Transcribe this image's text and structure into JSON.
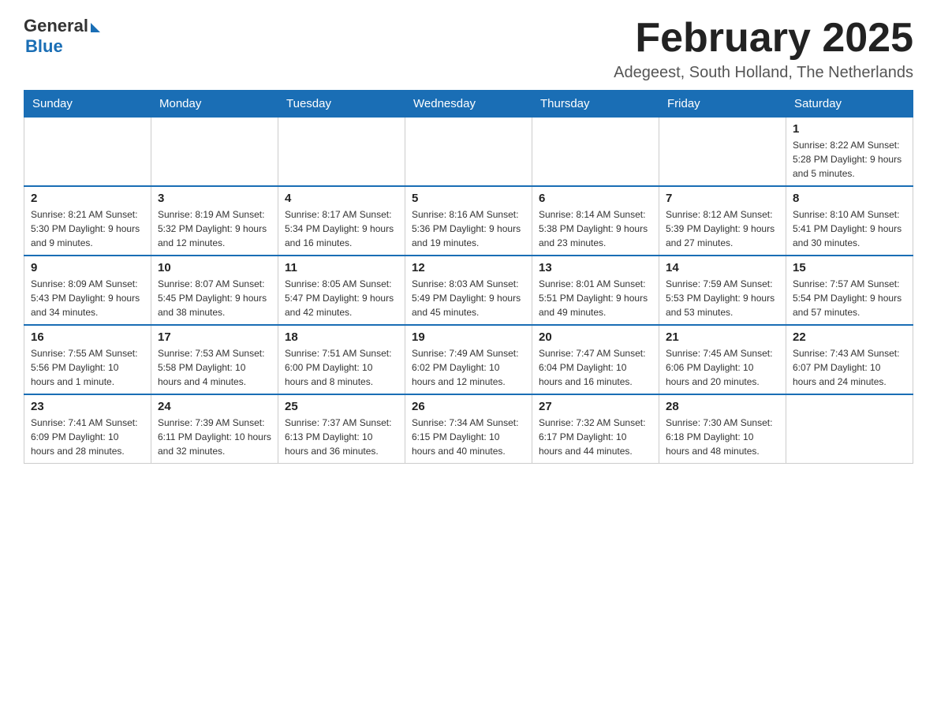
{
  "logo": {
    "general": "General",
    "blue": "Blue"
  },
  "header": {
    "title": "February 2025",
    "subtitle": "Adegeest, South Holland, The Netherlands"
  },
  "days_of_week": [
    "Sunday",
    "Monday",
    "Tuesday",
    "Wednesday",
    "Thursday",
    "Friday",
    "Saturday"
  ],
  "weeks": [
    [
      {
        "day": "",
        "info": ""
      },
      {
        "day": "",
        "info": ""
      },
      {
        "day": "",
        "info": ""
      },
      {
        "day": "",
        "info": ""
      },
      {
        "day": "",
        "info": ""
      },
      {
        "day": "",
        "info": ""
      },
      {
        "day": "1",
        "info": "Sunrise: 8:22 AM\nSunset: 5:28 PM\nDaylight: 9 hours and 5 minutes."
      }
    ],
    [
      {
        "day": "2",
        "info": "Sunrise: 8:21 AM\nSunset: 5:30 PM\nDaylight: 9 hours and 9 minutes."
      },
      {
        "day": "3",
        "info": "Sunrise: 8:19 AM\nSunset: 5:32 PM\nDaylight: 9 hours and 12 minutes."
      },
      {
        "day": "4",
        "info": "Sunrise: 8:17 AM\nSunset: 5:34 PM\nDaylight: 9 hours and 16 minutes."
      },
      {
        "day": "5",
        "info": "Sunrise: 8:16 AM\nSunset: 5:36 PM\nDaylight: 9 hours and 19 minutes."
      },
      {
        "day": "6",
        "info": "Sunrise: 8:14 AM\nSunset: 5:38 PM\nDaylight: 9 hours and 23 minutes."
      },
      {
        "day": "7",
        "info": "Sunrise: 8:12 AM\nSunset: 5:39 PM\nDaylight: 9 hours and 27 minutes."
      },
      {
        "day": "8",
        "info": "Sunrise: 8:10 AM\nSunset: 5:41 PM\nDaylight: 9 hours and 30 minutes."
      }
    ],
    [
      {
        "day": "9",
        "info": "Sunrise: 8:09 AM\nSunset: 5:43 PM\nDaylight: 9 hours and 34 minutes."
      },
      {
        "day": "10",
        "info": "Sunrise: 8:07 AM\nSunset: 5:45 PM\nDaylight: 9 hours and 38 minutes."
      },
      {
        "day": "11",
        "info": "Sunrise: 8:05 AM\nSunset: 5:47 PM\nDaylight: 9 hours and 42 minutes."
      },
      {
        "day": "12",
        "info": "Sunrise: 8:03 AM\nSunset: 5:49 PM\nDaylight: 9 hours and 45 minutes."
      },
      {
        "day": "13",
        "info": "Sunrise: 8:01 AM\nSunset: 5:51 PM\nDaylight: 9 hours and 49 minutes."
      },
      {
        "day": "14",
        "info": "Sunrise: 7:59 AM\nSunset: 5:53 PM\nDaylight: 9 hours and 53 minutes."
      },
      {
        "day": "15",
        "info": "Sunrise: 7:57 AM\nSunset: 5:54 PM\nDaylight: 9 hours and 57 minutes."
      }
    ],
    [
      {
        "day": "16",
        "info": "Sunrise: 7:55 AM\nSunset: 5:56 PM\nDaylight: 10 hours and 1 minute."
      },
      {
        "day": "17",
        "info": "Sunrise: 7:53 AM\nSunset: 5:58 PM\nDaylight: 10 hours and 4 minutes."
      },
      {
        "day": "18",
        "info": "Sunrise: 7:51 AM\nSunset: 6:00 PM\nDaylight: 10 hours and 8 minutes."
      },
      {
        "day": "19",
        "info": "Sunrise: 7:49 AM\nSunset: 6:02 PM\nDaylight: 10 hours and 12 minutes."
      },
      {
        "day": "20",
        "info": "Sunrise: 7:47 AM\nSunset: 6:04 PM\nDaylight: 10 hours and 16 minutes."
      },
      {
        "day": "21",
        "info": "Sunrise: 7:45 AM\nSunset: 6:06 PM\nDaylight: 10 hours and 20 minutes."
      },
      {
        "day": "22",
        "info": "Sunrise: 7:43 AM\nSunset: 6:07 PM\nDaylight: 10 hours and 24 minutes."
      }
    ],
    [
      {
        "day": "23",
        "info": "Sunrise: 7:41 AM\nSunset: 6:09 PM\nDaylight: 10 hours and 28 minutes."
      },
      {
        "day": "24",
        "info": "Sunrise: 7:39 AM\nSunset: 6:11 PM\nDaylight: 10 hours and 32 minutes."
      },
      {
        "day": "25",
        "info": "Sunrise: 7:37 AM\nSunset: 6:13 PM\nDaylight: 10 hours and 36 minutes."
      },
      {
        "day": "26",
        "info": "Sunrise: 7:34 AM\nSunset: 6:15 PM\nDaylight: 10 hours and 40 minutes."
      },
      {
        "day": "27",
        "info": "Sunrise: 7:32 AM\nSunset: 6:17 PM\nDaylight: 10 hours and 44 minutes."
      },
      {
        "day": "28",
        "info": "Sunrise: 7:30 AM\nSunset: 6:18 PM\nDaylight: 10 hours and 48 minutes."
      },
      {
        "day": "",
        "info": ""
      }
    ]
  ]
}
